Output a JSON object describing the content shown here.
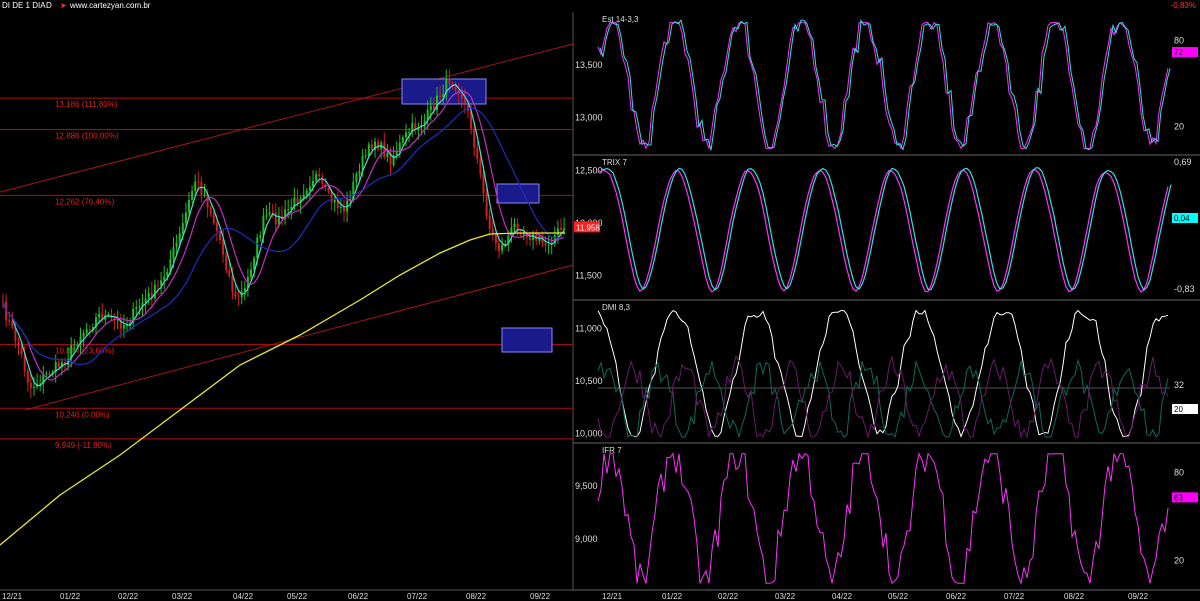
{
  "header": {
    "symbol": "DI DE 1 DIA",
    "period": "D",
    "url": "www.cartezyan.com.br",
    "change": "-0,83%"
  },
  "price_axis": {
    "ticks": [
      "13,500",
      "13,000",
      "12,500",
      "12,000",
      "11,500",
      "11,000",
      "10,500",
      "10,000",
      "9,500",
      "9,000"
    ],
    "tick_values": [
      13500,
      13000,
      12500,
      12000,
      11500,
      11000,
      10500,
      10000,
      9500,
      9000
    ]
  },
  "fib_levels": [
    {
      "label": "13,186 (111,80%)",
      "value": 13186
    },
    {
      "label": "12,886 (100,00%)",
      "value": 12886
    },
    {
      "label": "12,262 (76,40%)",
      "value": 12262
    },
    {
      "label": "10,844 (23,60%)",
      "value": 10844
    },
    {
      "label": "10,240 (0,00%)",
      "value": 10240
    },
    {
      "label": "9,949 (-11,80%)",
      "value": 9949
    }
  ],
  "last_price": {
    "label": "11,958",
    "value": 11958,
    "color": "#ff2020"
  },
  "x_axis_left": [
    "12/21",
    "01/22",
    "02/22",
    "03/22",
    "04/22",
    "05/22",
    "06/22",
    "07/22",
    "08/22",
    "09/22"
  ],
  "x_axis_right": [
    "12/21",
    "01/22",
    "02/22",
    "03/22",
    "04/22",
    "05/22",
    "06/22",
    "07/22",
    "08/22",
    "09/22"
  ],
  "panels": {
    "stoch": {
      "title": "Est 14-3,3",
      "ticks": [
        "80",
        "20"
      ],
      "tick_values": [
        80,
        20
      ],
      "current": "72",
      "current_value": 72,
      "current_color": "#ff00ff"
    },
    "trix": {
      "title": "TRIX 7",
      "ticks": [
        "0,69",
        "-0,83"
      ],
      "tick_values": [
        0.69,
        -0.83
      ],
      "current": "0,04",
      "current_value": 0.04,
      "current_color": "#00ffff"
    },
    "dmi": {
      "title": "DMI 8,3",
      "ticks": [
        "32"
      ],
      "tick_values": [
        32
      ],
      "current": "20",
      "current_value": 20,
      "current_color": "#ffffff"
    },
    "ifr": {
      "title": "IFR 7",
      "ticks": [
        "80",
        "20"
      ],
      "tick_values": [
        80,
        20
      ],
      "current": "63",
      "current_value": 63,
      "current_color": "#ff00ff"
    }
  },
  "colors": {
    "sma_long": "#e8e830",
    "ema_mid": "#1a2fbf",
    "ma_short_cyan": "#40e0d0",
    "ma_short_magenta": "#c030c0",
    "candle_up": "#1fbf1f",
    "candle_down": "#d02020",
    "fib_line": "#b01010",
    "channel_line": "#a01818",
    "zone_box": "#1a1a8a"
  },
  "chart_data": [
    {
      "type": "candlestick",
      "title": "DI DE 1 DIA",
      "x": [
        "12/21",
        "01/22",
        "02/22",
        "03/22",
        "04/22",
        "05/22",
        "06/22",
        "07/22",
        "08/22",
        "09/22"
      ],
      "close_approx": [
        11100,
        10350,
        11100,
        11400,
        11300,
        12200,
        12700,
        13100,
        12000,
        11950
      ],
      "ylim": [
        8450,
        13870
      ],
      "overlays": [
        "moving averages",
        "fibonacci levels",
        "trend channel"
      ]
    },
    {
      "type": "line",
      "title": "Est 14-3,3",
      "ylim": [
        0,
        100
      ],
      "last": 72
    },
    {
      "type": "line",
      "title": "TRIX 7",
      "ylim": [
        -0.83,
        0.69
      ],
      "last": 0.04
    },
    {
      "type": "line",
      "title": "DMI 8,3",
      "last": 20
    },
    {
      "type": "line",
      "title": "IFR 7",
      "ylim": [
        0,
        100
      ],
      "last": 63
    }
  ]
}
